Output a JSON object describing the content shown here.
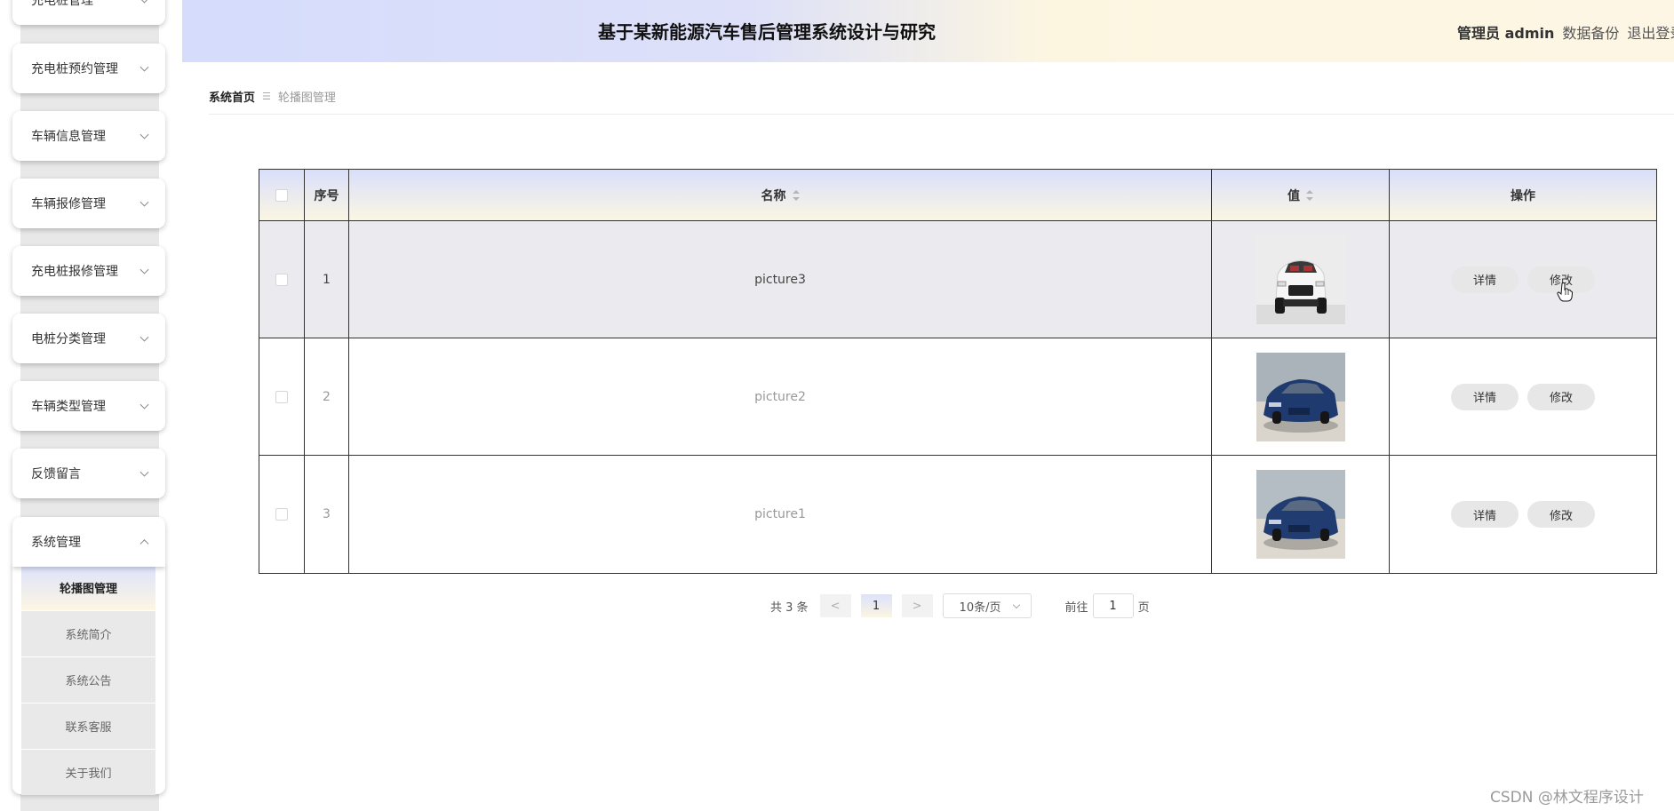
{
  "app": {
    "title": "基于某新能源汽车售后管理系统设计与研究",
    "admin_label": "管理员 admin",
    "backup_label": "数据备份",
    "logout_label": "退出登录"
  },
  "sidebar": {
    "items": [
      {
        "label": "充电桩管理"
      },
      {
        "label": "充电桩预约管理"
      },
      {
        "label": "车辆信息管理"
      },
      {
        "label": "车辆报修管理"
      },
      {
        "label": "充电桩报修管理"
      },
      {
        "label": "电桩分类管理"
      },
      {
        "label": "车辆类型管理"
      },
      {
        "label": "反馈留言"
      },
      {
        "label": "系统管理"
      }
    ],
    "subitems": [
      {
        "label": "轮播图管理",
        "active": true
      },
      {
        "label": "系统简介"
      },
      {
        "label": "系统公告"
      },
      {
        "label": "联系客服"
      },
      {
        "label": "关于我们"
      }
    ]
  },
  "breadcrumb": {
    "home": "系统首页",
    "separator": "☰",
    "current": "轮播图管理"
  },
  "table": {
    "headers": {
      "index": "序号",
      "name": "名称",
      "value": "值",
      "actions": "操作"
    },
    "rows": [
      {
        "index": "1",
        "name": "picture3",
        "image": "white-car-front",
        "detail": "详情",
        "edit": "修改"
      },
      {
        "index": "2",
        "name": "picture2",
        "image": "blue-car-side",
        "detail": "详情",
        "edit": "修改"
      },
      {
        "index": "3",
        "name": "picture1",
        "image": "blue-car-side",
        "detail": "详情",
        "edit": "修改"
      }
    ]
  },
  "pagination": {
    "total": "共 3 条",
    "prev": "<",
    "page": "1",
    "next": ">",
    "page_size": "10条/页",
    "goto_label": "前往",
    "goto_value": "1",
    "page_unit": "页"
  },
  "watermark": "CSDN @林文程序设计",
  "colors": {
    "header_left": "#d5dcfc",
    "header_right": "#fdf6e4",
    "button_bg": "#e7e7e7",
    "border": "#333333"
  }
}
